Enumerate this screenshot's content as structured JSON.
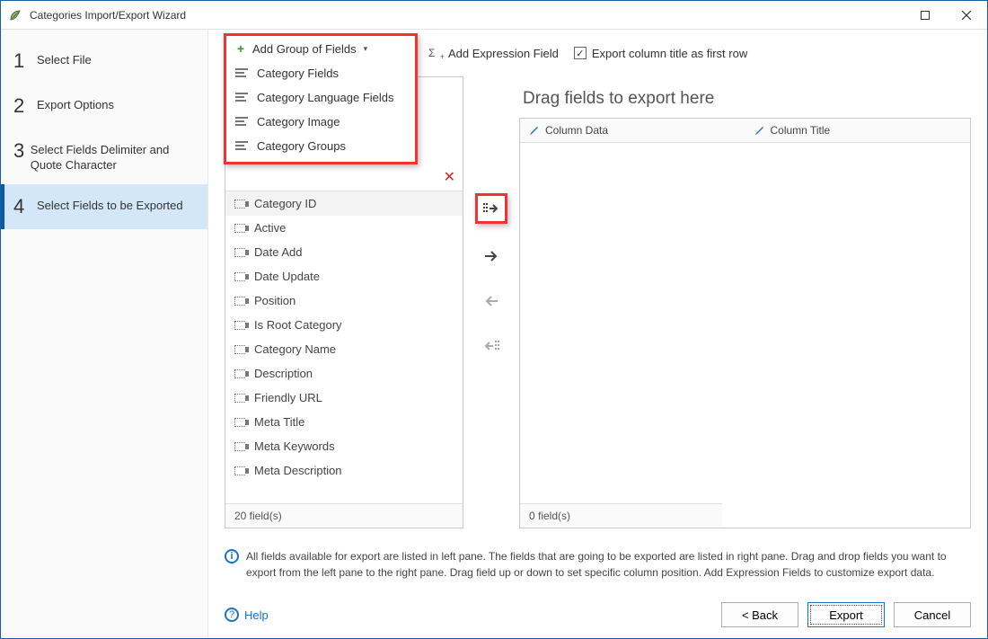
{
  "window": {
    "title": "Categories Import/Export Wizard"
  },
  "steps": [
    {
      "num": "1",
      "label": "Select File"
    },
    {
      "num": "2",
      "label": "Export Options"
    },
    {
      "num": "3",
      "label": "Select Fields Delimiter and Quote Character"
    },
    {
      "num": "4",
      "label": "Select Fields to be Exported"
    }
  ],
  "active_step": 3,
  "toolbar": {
    "add_group": "Add Group of Fields",
    "add_expr": "Add Expression Field",
    "export_first_row": "Export column title as first row",
    "export_first_row_checked": true
  },
  "dropdown": {
    "items": [
      "Category Fields",
      "Category Language Fields",
      "Category Image",
      "Category Groups"
    ]
  },
  "leftpane": {
    "fields": [
      "Category ID",
      "Active",
      "Date Add",
      "Date Update",
      "Position",
      "Is Root Category",
      "Category Name",
      "Description",
      "Friendly URL",
      "Meta Title",
      "Meta Keywords",
      "Meta Description"
    ],
    "count": "20 field(s)"
  },
  "rightpane": {
    "drop_title": "Drag fields to export here",
    "col_data": "Column Data",
    "col_title": "Column Title",
    "count": "0 field(s)"
  },
  "info": "All fields available for export are listed in left pane. The fields that are going to be exported are listed in right pane. Drag and drop fields you want to export from the left pane to the right pane. Drag field up or down to set specific column position. Add Expression Fields to customize export data.",
  "help": "Help",
  "buttons": {
    "back": "< Back",
    "export": "Export",
    "cancel": "Cancel"
  }
}
